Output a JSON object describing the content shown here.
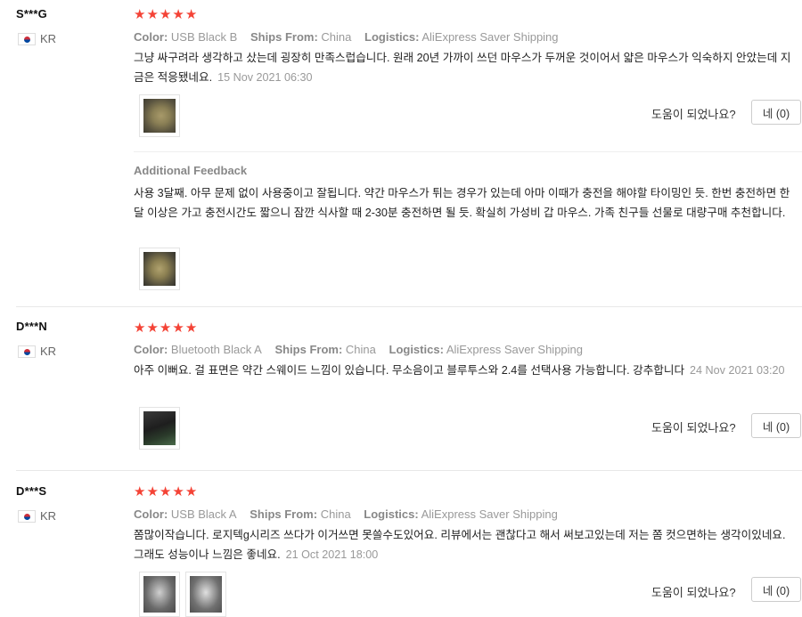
{
  "labels": {
    "color": "Color:",
    "ships_from": "Ships From:",
    "logistics": "Logistics:",
    "helpful_question": "도움이 되었나요?",
    "additional_feedback": "Additional Feedback"
  },
  "star_glyph": "★",
  "star_color": "#f44336",
  "reviews": [
    {
      "user": "S***G",
      "country": "KR",
      "rating": 5,
      "color": "USB Black B",
      "ships_from": "China",
      "logistics": "AliExpress Saver Shipping",
      "text": "그냥 싸구려라 생각하고 샀는데 굉장히 만족스럽습니다. 원래 20년 가까이 쓰던 마우스가 두꺼운 것이어서 얇은 마우스가 익숙하지 안았는데 지금은 적응됐네요.",
      "date": "15 Nov 2021 06:30",
      "vote_label": "네 (0)",
      "additional_text": "사용 3달째. 아무 문제 없이 사용중이고 잘됩니다. 약간 마우스가 튀는 경우가 있는데 아마 이때가 충전을 해야할 타이밍인 듯. 한번 충전하면 한달 이상은 가고 충전시간도 짧으니 잠깐 식사할 때 2-30분 충전하면 될 듯. 확실히 가성비 갑 마우스. 가족 친구들 선물로 대량구매 추천합니다."
    },
    {
      "user": "D***N",
      "country": "KR",
      "rating": 5,
      "color": "Bluetooth Black A",
      "ships_from": "China",
      "logistics": "AliExpress Saver Shipping",
      "text": "아주 이뻐요. 걸 표면은 약간 스웨이드 느낌이 있습니다. 무소음이고 블루투스와 2.4를 선택사용 가능합니다. 강추합니다",
      "date": "24 Nov 2021 03:20",
      "vote_label": "네 (0)"
    },
    {
      "user": "D***S",
      "country": "KR",
      "rating": 5,
      "color": "USB Black A",
      "ships_from": "China",
      "logistics": "AliExpress Saver Shipping",
      "text": "쫌많이작습니다. 로지텍g시리즈 쓰다가 이거쓰면 못쓸수도있어요. 리뷰에서는 괜찮다고 해서 써보고있는데 저는 쫌 컷으면하는 생각이있네요. 그래도 성능이나 느낌은 좋네요.",
      "date": "21 Oct 2021 18:00",
      "vote_label": "네 (0)"
    }
  ]
}
